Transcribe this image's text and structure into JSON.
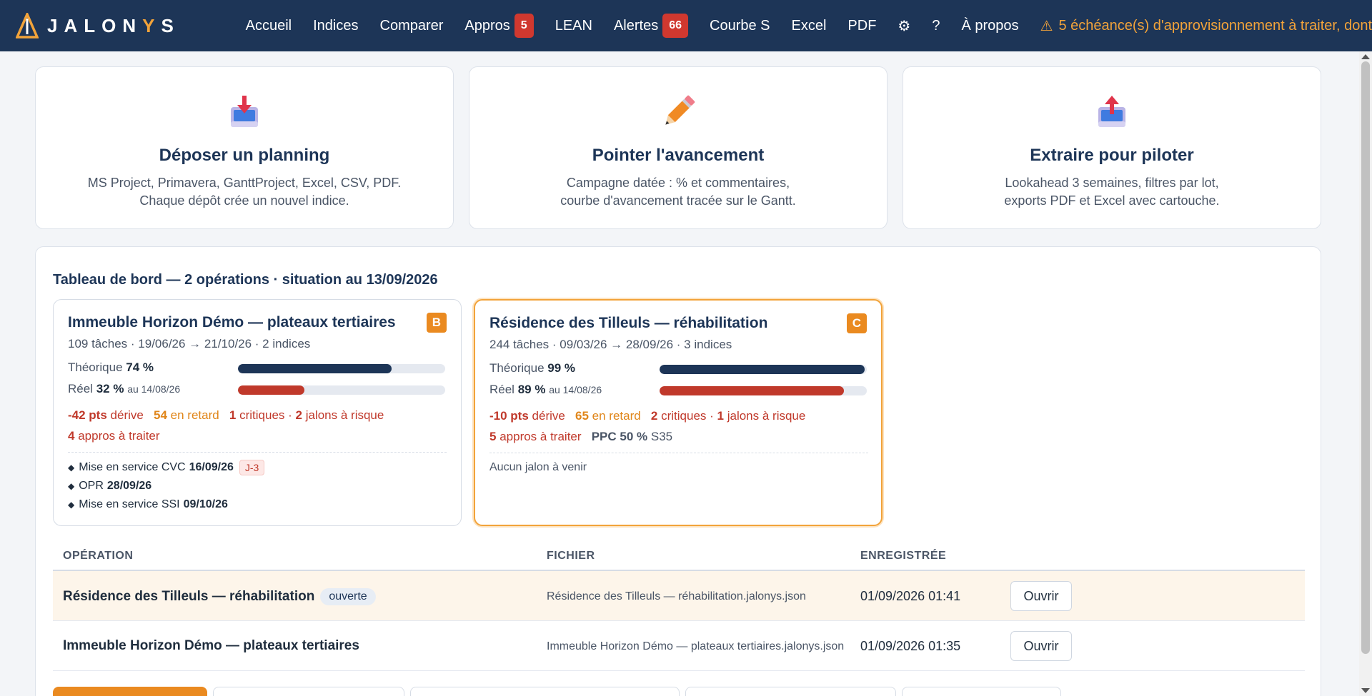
{
  "brand": {
    "name_prefix": "JALON",
    "name_y": "Y",
    "name_suffix": "S"
  },
  "nav": {
    "accueil": "Accueil",
    "indices": "Indices",
    "comparer": "Comparer",
    "appros": "Appros",
    "appros_count": "5",
    "lean": "LEAN",
    "alertes": "Alertes",
    "alertes_count": "66",
    "courbe_s": "Courbe S",
    "excel": "Excel",
    "pdf": "PDF",
    "settings_glyph": "⚙",
    "help": "?",
    "apropos": "À propos",
    "alert_text": "5 échéance(s) d'approvisionnement à traiter, dont"
  },
  "features": [
    {
      "icon": "inbox-download-icon",
      "title": "Déposer un planning",
      "line1": "MS Project, Primavera, GanttProject, Excel, CSV, PDF.",
      "line2": "Chaque dépôt crée un nouvel indice."
    },
    {
      "icon": "pencil-icon",
      "title": "Pointer l'avancement",
      "line1": "Campagne datée : % et commentaires,",
      "line2": "courbe d'avancement tracée sur le Gantt."
    },
    {
      "icon": "outbox-upload-icon",
      "title": "Extraire pour piloter",
      "line1": "Lookahead 3 semaines, filtres par lot,",
      "line2": "exports PDF et Excel avec cartouche."
    }
  ],
  "dashboard": {
    "title": "Tableau de bord — 2 opérations · situation au 13/09/2026",
    "operations": [
      {
        "title": "Immeuble Horizon Démo — plateaux tertiaires",
        "grade": "B",
        "meta": "109 tâches · 19/06/26 → 21/10/26 · 2 indices",
        "theo_label": "Théorique",
        "theo_value": "74 %",
        "theo_pct": 74,
        "reel_label": "Réel",
        "reel_value": "32 %",
        "reel_date": "au 14/08/26",
        "reel_pct": 32,
        "derive": "-42 pts",
        "derive_label": "dérive",
        "retard": "54",
        "retard_label": "en retard",
        "critiques": "1",
        "critiques_label": "critiques ·",
        "jalons": "2",
        "jalons_label": "jalons à risque",
        "appros": "4",
        "appros_label": "appros à traiter",
        "milestones": [
          {
            "label": "Mise en service CVC",
            "date": "16/09/26",
            "tag": "J-3"
          },
          {
            "label": "OPR",
            "date": "28/09/26"
          },
          {
            "label": "Mise en service SSI",
            "date": "09/10/26"
          }
        ]
      },
      {
        "title": "Résidence des Tilleuls — réhabilitation",
        "grade": "C",
        "meta": "244 tâches · 09/03/26 → 28/09/26 · 3 indices",
        "theo_label": "Théorique",
        "theo_value": "99 %",
        "theo_pct": 99,
        "reel_label": "Réel",
        "reel_value": "89 %",
        "reel_date": "au 14/08/26",
        "reel_pct": 89,
        "derive": "-10 pts",
        "derive_label": "dérive",
        "retard": "65",
        "retard_label": "en retard",
        "critiques": "2",
        "critiques_label": "critiques ·",
        "jalons": "1",
        "jalons_label": "jalons à risque",
        "appros": "5",
        "appros_label": "appros à traiter",
        "ppc_label": "PPC 50 %",
        "ppc_week": "S35",
        "no_milestone": "Aucun jalon à venir"
      }
    ]
  },
  "table": {
    "headers": {
      "operation": "OPÉRATION",
      "file": "FICHIER",
      "saved": "ENREGISTRÉE"
    },
    "rows": [
      {
        "operation": "Résidence des Tilleuls — réhabilitation",
        "badge": "ouverte",
        "file": "Résidence des Tilleuls — réhabilitation.jalonys.json",
        "saved": "01/09/2026 01:41",
        "action": "Ouvrir"
      },
      {
        "operation": "Immeuble Horizon Démo — plateaux tertiaires",
        "file": "Immeuble Horizon Démo — plateaux tertiaires.jalonys.json",
        "saved": "01/09/2026 01:35",
        "action": "Ouvrir"
      }
    ]
  },
  "colors": {
    "navy": "#1d3557",
    "orange": "#ea8a20",
    "red": "#c0392b",
    "amber": "#f2a33a"
  }
}
